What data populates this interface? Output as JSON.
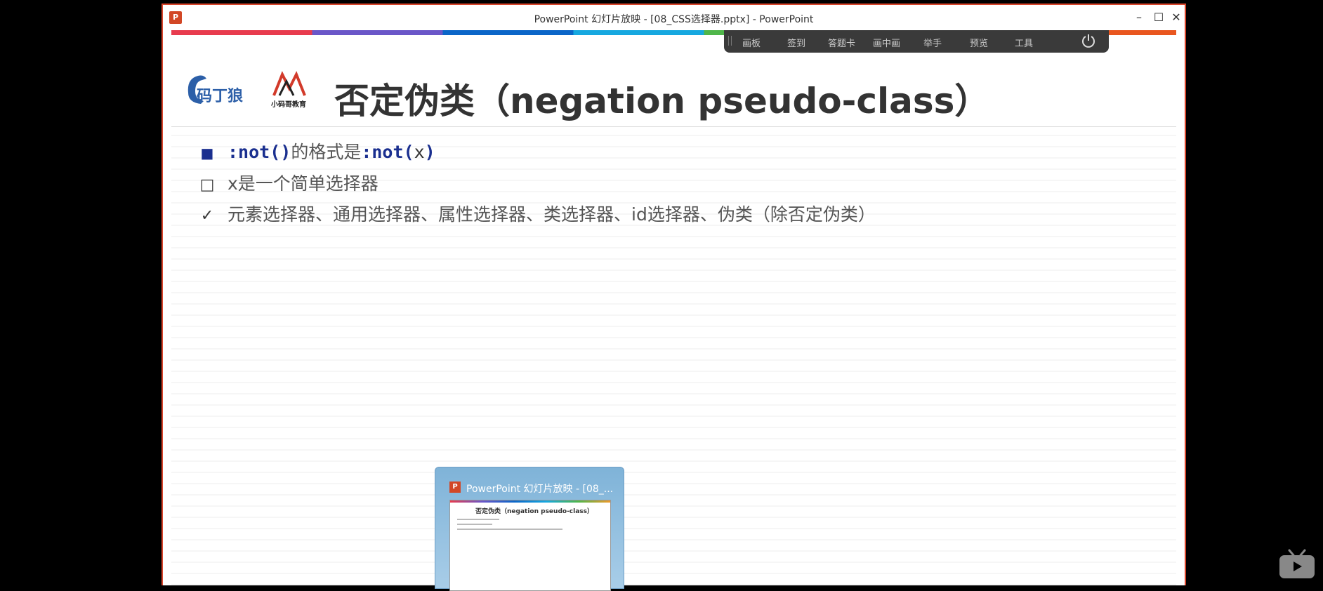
{
  "window": {
    "app_icon": "P",
    "title": "PowerPoint 幻灯片放映 - [08_CSS选择器.pptx] - PowerPoint",
    "min_icon": "–",
    "max_icon": "☐",
    "close_icon": "✕"
  },
  "toolbar": {
    "items": [
      "画板",
      "签到",
      "答题卡",
      "画中画",
      "举手",
      "预览",
      "工具"
    ]
  },
  "slide": {
    "logo1_text": "码丁狼",
    "logo2_text": "小码哥教育",
    "title": "否定伪类（negation pseudo-class）",
    "bullets": [
      {
        "marker": "■",
        "code": ":not()",
        "text": "的格式是",
        "code2": ":not(",
        "x": "x",
        "close": ")"
      },
      {
        "marker": "□",
        "text": "x是一个简单选择器"
      },
      {
        "marker": "✓",
        "text": "元素选择器、通用选择器、属性选择器、类选择器、id选择器、伪类（除否定伪类）"
      }
    ]
  },
  "taskbar_preview": {
    "icon": "P",
    "title": "PowerPoint 幻灯片放映 - [08_...",
    "inner_title": "否定伪类（negation pseudo-class）"
  },
  "colors": {
    "accent_red": "#d9452b",
    "title_gray": "#333333",
    "code_blue": "#1a2f8f",
    "toolbar_bg": "#3a3a3a"
  }
}
